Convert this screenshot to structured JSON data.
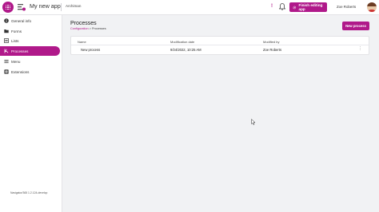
{
  "header": {
    "app_title": "My new app",
    "environment": "Archiman",
    "alert_glyph": "!",
    "finish_button": "Finish editing app",
    "user_name": "Zoe Roberts",
    "accent_color": "#b0198a"
  },
  "sidebar": {
    "items": [
      {
        "label": "General info",
        "icon": "info-icon"
      },
      {
        "label": "Forms",
        "icon": "folder-icon"
      },
      {
        "label": "Lists",
        "icon": "list-icon"
      },
      {
        "label": "Processes",
        "icon": "process-icon",
        "active": true
      },
      {
        "label": "Menu",
        "icon": "menu-icon"
      },
      {
        "label": "Extensions",
        "icon": "extension-icon"
      }
    ],
    "version": "Navigator/365 1.2.124-develop"
  },
  "main": {
    "title": "Processes",
    "breadcrumb": {
      "parent": "Configuration",
      "separator": ">",
      "current": "Processes"
    },
    "new_button": "New process",
    "table": {
      "columns": [
        "Name",
        "Modification date",
        "Modified by"
      ],
      "rows": [
        {
          "name": "New process",
          "modified": "9/24/2022, 10:25 AM",
          "modified_by": "Zoe Roberts"
        }
      ],
      "row_menu_glyph": "⋮"
    }
  }
}
